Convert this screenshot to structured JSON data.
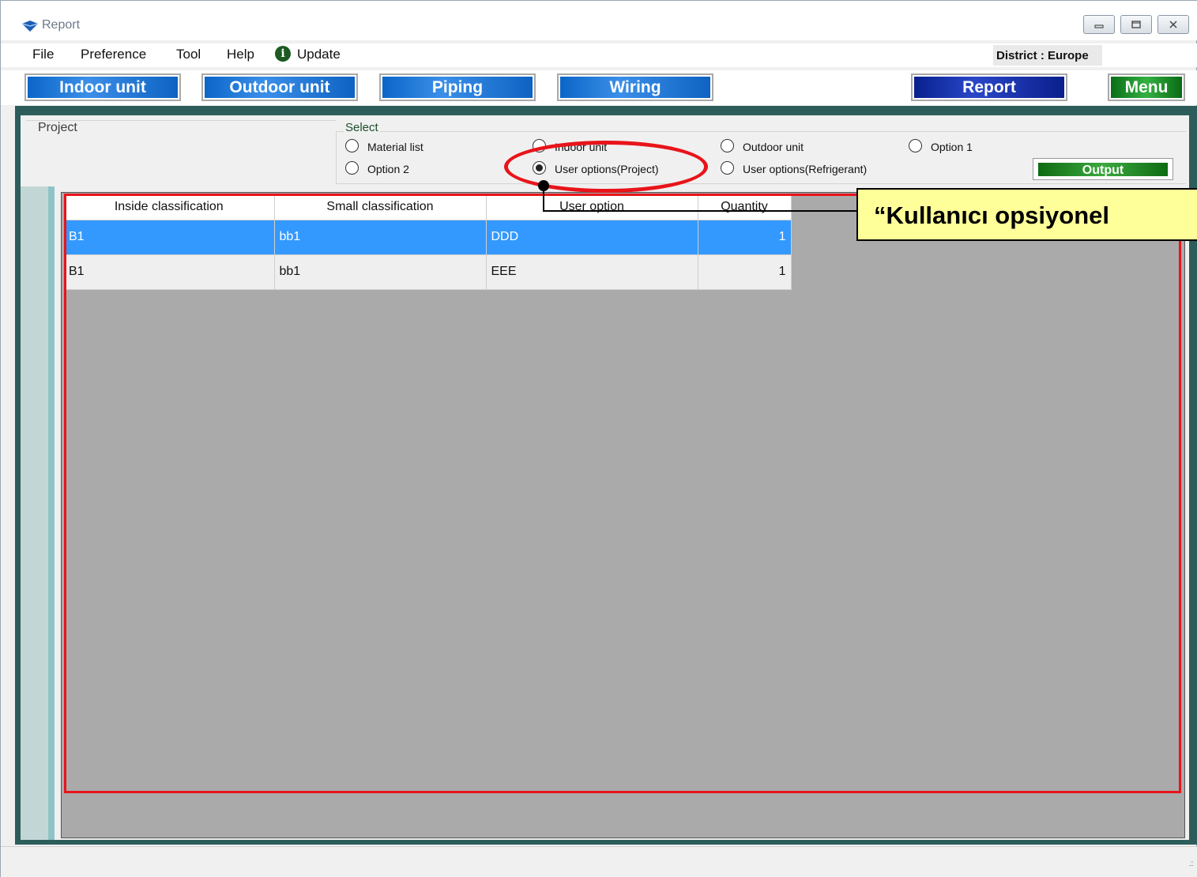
{
  "window": {
    "title": "Report",
    "controls": [
      "minimize",
      "maximize",
      "close"
    ]
  },
  "menubar": {
    "items": [
      "File",
      "Preference",
      "Tool",
      "Help"
    ],
    "update_label": "Update",
    "district": "District : Europe"
  },
  "toolbar": {
    "indoor": "Indoor unit",
    "outdoor": "Outdoor unit",
    "piping": "Piping",
    "wiring": "Wiring",
    "report": "Report",
    "menu": "Menu"
  },
  "project": {
    "label": "Project"
  },
  "select": {
    "label": "Select",
    "options": [
      {
        "label": "Material list",
        "checked": false
      },
      {
        "label": "Indoor unit",
        "checked": false
      },
      {
        "label": "Outdoor unit",
        "checked": false
      },
      {
        "label": "Option 1",
        "checked": false
      },
      {
        "label": "Option 2",
        "checked": false
      },
      {
        "label": "User options(Project)",
        "checked": true
      },
      {
        "label": "User options(Refrigerant)",
        "checked": false
      }
    ],
    "output_label": "Output"
  },
  "grid": {
    "columns": [
      "Inside classification",
      "Small classification",
      "User option",
      "Quantity"
    ],
    "rows": [
      {
        "inside": "B1",
        "small": "bb1",
        "option": "DDD",
        "quantity": "1",
        "selected": true
      },
      {
        "inside": "B1",
        "small": "bb1",
        "option": "EEE",
        "quantity": "1",
        "selected": false
      }
    ]
  },
  "annotation": {
    "callout_text": "“Kullanıcı opsiyonel",
    "highlight_color": "#e8141a",
    "callout_bg": "#ffff99"
  }
}
